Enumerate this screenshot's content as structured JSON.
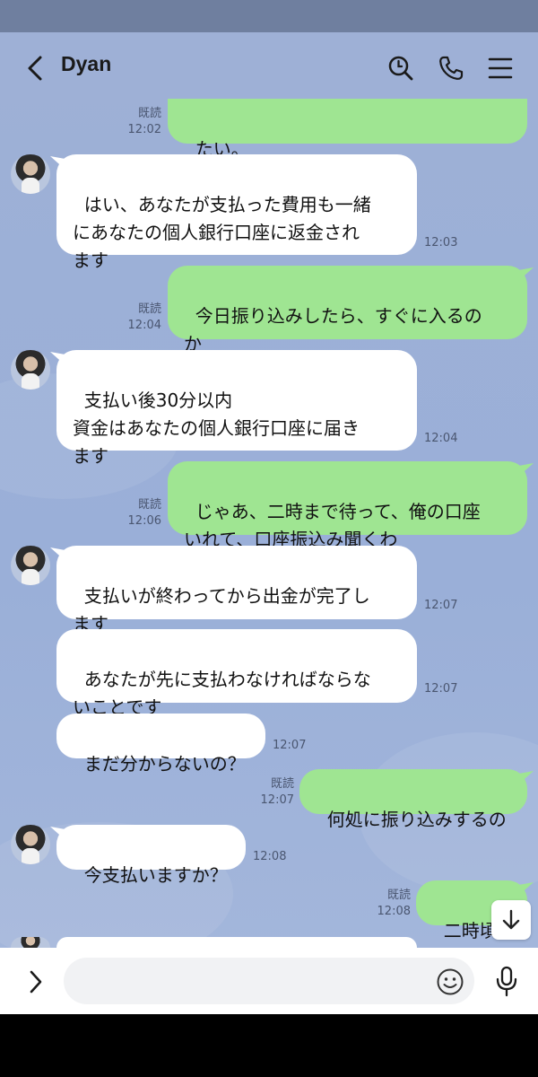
{
  "header": {
    "title": "Dyan"
  },
  "messages": [
    {
      "text": "たい。",
      "read": "既読",
      "time": "12:02"
    },
    {
      "text": "はい、あなたが支払った費用も一緒\nにあなたの個人銀行口座に返金され\nます",
      "time": "12:03"
    },
    {
      "text": "今日振り込みしたら、すぐに入るの\nか",
      "read": "既読",
      "time": "12:04"
    },
    {
      "text": "支払い後30分以内\n資金はあなたの個人銀行口座に届き\nます",
      "time": "12:04"
    },
    {
      "text": "じゃあ、二時まで待って、俺の口座\nいれて、口座振込み聞くわ",
      "read": "既読",
      "time": "12:06"
    },
    {
      "text": "支払いが終わってから出金が完了し\nます",
      "time": "12:07"
    },
    {
      "text": "あなたが先に支払わなければならな\nいことです",
      "time": "12:07"
    },
    {
      "text": "まだ分からないの？",
      "time": "12:07"
    },
    {
      "text": "何処に振り込みするの",
      "read": "既読",
      "time": "12:07"
    },
    {
      "text": "今支払いますか？",
      "time": "12:08"
    },
    {
      "text": "二時頃",
      "read": "既読",
      "time": "12:08"
    }
  ],
  "input": {
    "placeholder": "",
    "value": ""
  },
  "colors": {
    "outgoing": "#9fe592",
    "incoming": "#ffffff",
    "background": "#9eb0d6"
  },
  "icons": [
    "back-icon",
    "search-icon",
    "phone-icon",
    "menu-icon",
    "scroll-down-icon",
    "expand-icon",
    "emoji-icon",
    "mic-icon"
  ]
}
